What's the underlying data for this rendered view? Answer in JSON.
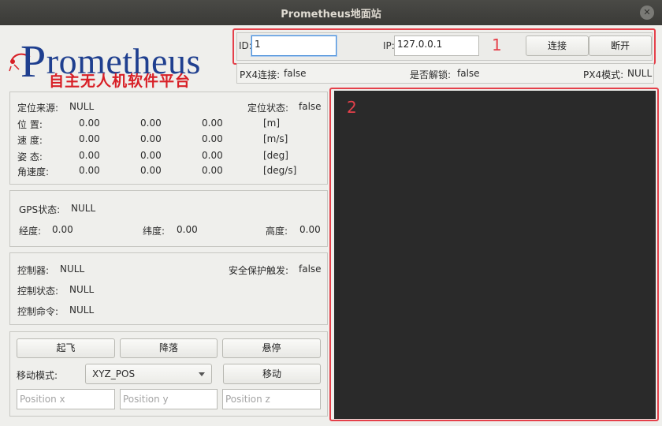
{
  "window": {
    "title": "Prometheus地面站"
  },
  "logo": {
    "brand": "rometheus",
    "brand_initial": "P",
    "subtitle": "自主无人机软件平台"
  },
  "connection": {
    "id_label": "ID:",
    "id_value": "1",
    "ip_label": "IP:",
    "ip_value": "127.0.0.1",
    "connect_label": "连接",
    "disconnect_label": "断开",
    "annotation": "1"
  },
  "status": {
    "px4_connect_label": "PX4连接:",
    "px4_connect_value": "false",
    "armed_label": "是否解锁:",
    "armed_value": "false",
    "px4_mode_label": "PX4模式:",
    "px4_mode_value": "NULL"
  },
  "state_panel": {
    "source_label": "定位来源:",
    "source_value": "NULL",
    "loc_status_label": "定位状态:",
    "loc_status_value": "false",
    "rows": [
      {
        "label": "位  置:",
        "x": "0.00",
        "y": "0.00",
        "z": "0.00",
        "unit": "[m]"
      },
      {
        "label": "速  度:",
        "x": "0.00",
        "y": "0.00",
        "z": "0.00",
        "unit": "[m/s]"
      },
      {
        "label": "姿  态:",
        "x": "0.00",
        "y": "0.00",
        "z": "0.00",
        "unit": "[deg]"
      },
      {
        "label": "角速度:",
        "x": "0.00",
        "y": "0.00",
        "z": "0.00",
        "unit": "[deg/s]"
      }
    ]
  },
  "gps_panel": {
    "gps_status_label": "GPS状态:",
    "gps_status_value": "NULL",
    "lon_label": "经度:",
    "lon_value": "0.00",
    "lat_label": "纬度:",
    "lat_value": "0.00",
    "alt_label": "高度:",
    "alt_value": "0.00"
  },
  "control_panel": {
    "controller_label": "控制器:",
    "controller_value": "NULL",
    "safety_label": "安全保护触发:",
    "safety_value": "false",
    "ctrl_state_label": "控制状态:",
    "ctrl_state_value": "NULL",
    "ctrl_cmd_label": "控制命令:",
    "ctrl_cmd_value": "NULL"
  },
  "command_panel": {
    "takeoff_label": "起飞",
    "land_label": "降落",
    "hover_label": "悬停",
    "move_mode_label": "移动模式:",
    "move_mode_value": "XYZ_POS",
    "move_label": "移动",
    "pos_x_placeholder": "Position x",
    "pos_y_placeholder": "Position y",
    "pos_z_placeholder": "Position z"
  },
  "preview": {
    "annotation": "2"
  }
}
